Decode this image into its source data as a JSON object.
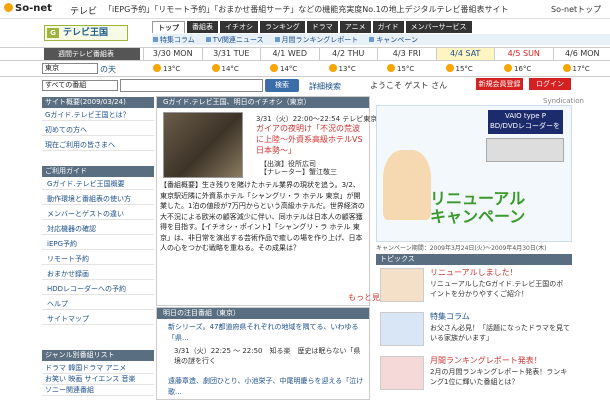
{
  "topbar": {
    "brand": "So-net",
    "section": "テレビ",
    "headline": "「iEPG予約」「リモート予約」「おまかせ番組サーチ」などの機能充実度No.1の地上デジタルテレビ番組表サイト",
    "sonet_top": "So-netトップ"
  },
  "logo": {
    "text": "テレビ王国",
    "badge": "G"
  },
  "nav": {
    "tabs": [
      "トップ",
      "番組表",
      "イチオシ",
      "ランキング",
      "ドラマ",
      "アニメ",
      "ガイド",
      "メンバーサービス"
    ],
    "active": 0,
    "subitems": [
      "特集コラム",
      "TV関連ニュース",
      "月間ランキングレポート",
      "キャンペーン"
    ]
  },
  "week": {
    "label": "週間テレビ番組表",
    "days": [
      "3/30 MON",
      "3/31 TUE",
      "4/1 WED",
      "4/2 THU",
      "4/3 FRI",
      "4/4 SAT",
      "4/5 SUN",
      "4/6 MON"
    ],
    "today_index": 5
  },
  "region": {
    "label": "地域設定",
    "value": "東京",
    "link": "の天",
    "weather": [
      "13°C",
      "14°C",
      "14°C",
      "13°C",
      "15°C",
      "15°C",
      "16°C",
      "17°C"
    ],
    "weather_low": [
      "17°C"
    ]
  },
  "search": {
    "scope": "すべての番組",
    "button": "検索",
    "advanced": "詳細検索",
    "welcome": "ようこそ ゲスト さん",
    "register": "新規会員登録",
    "login": "ログイン"
  },
  "left": {
    "overview_head": "サイト概要(2009/03/24)",
    "overview": [
      "Gガイド.テレビ王国とは？",
      "初めての方へ",
      "現在ご利用の皆さまへ"
    ],
    "usage_head": "ご利用ガイド",
    "usage": [
      "Gガイド.テレビ王国概要",
      "動作環境と番組表の使い方",
      "メンバーとゲストの違い",
      "対応機器の確認",
      "iEPG予約",
      "リモート予約",
      "おまかせ録画",
      "HDDレコーダーへの予約",
      "ヘルプ",
      "サイトマップ"
    ],
    "genre_head": "ジャンル別番組リスト",
    "genre": [
      "ドラマ 韓国ドラマ アニメ",
      "お笑い 映画 サイエンス 音楽",
      "ソニー関連番組"
    ]
  },
  "guide": {
    "head": "Gガイド.テレビ王国、明日のイチオシ（東京）",
    "time": "3/31（火）22:00〜22:54 テレビ東京",
    "title": "ガイアの夜明け「不況の荒波に上陸〜外資系高級ホテルVS日本勢〜」",
    "cast1": "【出演】役所広司",
    "cast2": "【ナレーター】蟹江敬三",
    "body": "【番組概要】生き残りを賭けたホテル業界の現状を追う。3/2、東京駅近隣に外資系ホテル「シャングリ・ラ ホテル 東京」が開業した。1泊の値段が7万円からという高級ホテルだ。世界経済の大不況による欧米の顧客減少に伴い、同ホテルは日本人の顧客獲得を目指す。【イチオシ・ポイント】「シャングリ・ラ ホテル 東京」は、非日常を演出する芸術作品で癒しの場を作り上げ、日本人の心をつかむ戦略を重ねる。その成果は？",
    "more": "もっと見る"
  },
  "attention": {
    "head": "明日の注目番組（東京）",
    "row1": "新シリーズ。47都道府県それぞれの地域を隅てる、いわゆる「県...",
    "row2": "3/31（火）22:25 〜 22:50　知る楽　歴史は眠らない「県境の謎を行く",
    "row3": "遠藤章造、劇団ひとり、小池栄子、中尾明慶らを迎える「泣け歌..."
  },
  "sidebar": {
    "label": "Syndication",
    "ad_brand": "VAIO type P",
    "ad_sub": "BD/DVDレコーダーを",
    "ad_main": "リニューアル\nキャンペーン",
    "ad_period": "キャンペーン期間：2009年3月24日(火)〜2009年4月30日(木)",
    "topics_head": "トピックス",
    "topics": [
      {
        "title": "リニューアルしました！",
        "body": "リニューアルしたGガイド.テレビ王国のポイントを分かりやすくご紹介！"
      },
      {
        "title": "特集コラム",
        "body": "お父さん必見！「話題になったドラマを見ている家族がいます」"
      },
      {
        "title": "月間ランキングレポート発表！",
        "body": "2月の月間ランキングレポート発表！ランキング1位に輝いた番組とは？"
      }
    ]
  }
}
